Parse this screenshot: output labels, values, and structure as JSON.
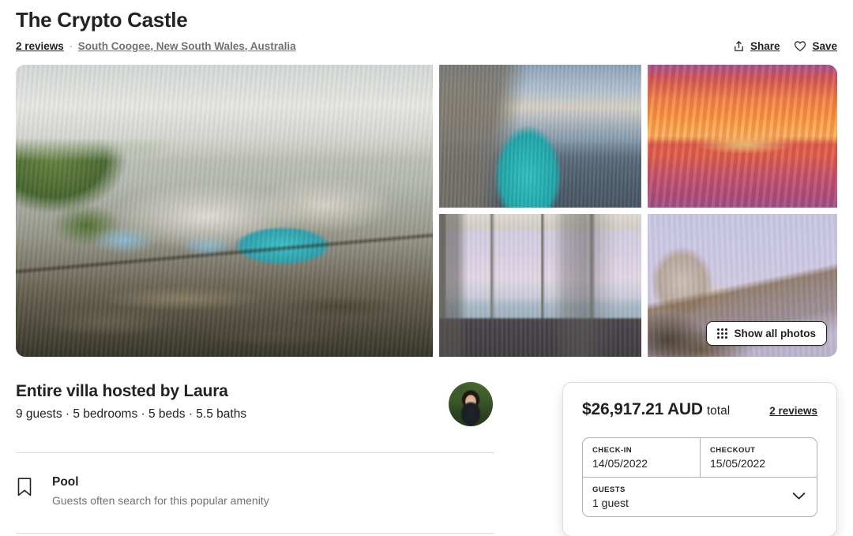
{
  "listing": {
    "title": "The Crypto Castle",
    "reviews_link": "2 reviews",
    "separator": "·",
    "location": "South Coogee, New South Wales, Australia"
  },
  "actions": {
    "share_label": "Share",
    "save_label": "Save",
    "share_icon": "share-upload-icon",
    "save_icon": "heart-icon"
  },
  "gallery": {
    "show_all_label": "Show all photos",
    "show_all_icon": "grid-dots-icon",
    "photos": [
      {
        "alt": "Aerial view of modern clifftop villa with turquoise pool"
      },
      {
        "alt": "Infinity pool on cliff edge overlooking the ocean"
      },
      {
        "alt": "Vivid orange sunset over the ocean from the deck"
      },
      {
        "alt": "Bedroom with floor-to-ceiling windows and sea view"
      },
      {
        "alt": "Villa lit up at dusk on the rocky headland"
      }
    ]
  },
  "host": {
    "title": "Entire villa hosted by Laura",
    "details": "9 guests · 5 bedrooms · 5 beds · 5.5 baths",
    "avatar_alt": "Host profile photo of Laura"
  },
  "amenity": {
    "icon": "bookmark-icon",
    "name": "Pool",
    "description": "Guests often search for this popular amenity"
  },
  "booking": {
    "price": "$26,917.21 AUD",
    "price_unit": "total",
    "reviews_link": "2 reviews",
    "checkin_label": "CHECK-IN",
    "checkin_value": "14/05/2022",
    "checkout_label": "CHECKOUT",
    "checkout_value": "15/05/2022",
    "guests_label": "GUESTS",
    "guests_value": "1 guest",
    "chevron_icon": "chevron-down-icon"
  },
  "colors": {
    "text_primary": "#222222",
    "text_muted": "#717171",
    "border": "#dddddd"
  }
}
